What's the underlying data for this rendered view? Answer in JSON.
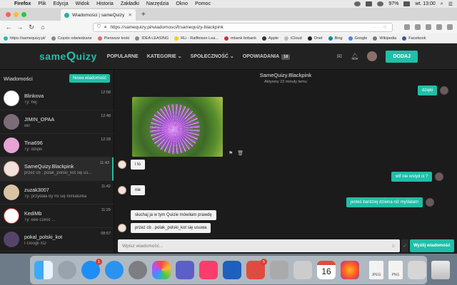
{
  "menubar": {
    "app": "Firefox",
    "items": [
      "Plik",
      "Edycja",
      "Widok",
      "Historia",
      "Zakładki",
      "Narzędzia",
      "Okno",
      "Pomoc"
    ],
    "battery": "97%",
    "clock": "wt. 13:00"
  },
  "browser": {
    "tab_title": "Wiadomości | sameQuizy",
    "new_tab": "+",
    "url": "https://samequizy.pl/wiadomosci/t/samequizy-blackpink",
    "url_actions": "··· ☆",
    "bookmarks": [
      "https://samequizy.pl/",
      "Często odwiedzane",
      "Pierwsze kroki",
      "IDEA LEASING",
      "RLi - Raiffeisen Lea...",
      "mbank bnbank",
      "Apple",
      "iCloud",
      "Onet",
      "Bing",
      "Google",
      "Wikipedia",
      "Facebook"
    ]
  },
  "site": {
    "logo_a": "same",
    "logo_q": "Q",
    "logo_b": "uizy",
    "nav": [
      "POPULARNE",
      "KATEGORIE",
      "SPOŁECZNOŚĆ",
      "OPOWIADANIA"
    ],
    "nav_chevron": "⌄",
    "opowiadania_badge": "18",
    "add_button": "DODAJ"
  },
  "inbox": {
    "title": "Wiadomości",
    "new_button": "Nowa wiadomość",
    "conversations": [
      {
        "name": "Blinkova",
        "preview": "Ty: hej",
        "time": "12:58"
      },
      {
        "name": "JIMIN_OPAA",
        "preview": "ok!",
        "time": "12:48"
      },
      {
        "name": "Tina696",
        "preview": "Ty: dzięki",
        "time": "12:28"
      },
      {
        "name": "SameQuizy.Blackpink",
        "preview": "przez cb . polak_polski_kot się us...",
        "time": "11:43"
      },
      {
        "name": "zuzak3007",
        "preview": "Ty: przydała by mi się miniaturka",
        "time": "11:42"
      },
      {
        "name": "KediMb",
        "preview": "Ty: eee cześć ...",
        "time": "11:29"
      },
      {
        "name": "pokal_polski_kot",
        "preview": "I Googli XD",
        "time": "08:57"
      }
    ]
  },
  "chat": {
    "name": "SameQuizy.Blackpink",
    "status": "Aktywny 23 minuty temu",
    "messages": {
      "m_dzieki": "dzięki",
      "m_i_to": "i to",
      "m_wtf": "wtf nie wstyd ci ?",
      "m_nie": "nie",
      "m_dziwna": "jesteś bardziej dziwna niż myślałam",
      "m_sluchaj": "słuchaj ja w tym Quizie mówiłam prawdę",
      "m_przez": "przez cb . polak_polski_kot się usuwa"
    },
    "composer_placeholder": "Wpisz wiadomość...",
    "send_button": "Wyślij wiadomość"
  },
  "dock": {
    "calendar_day": "16",
    "appstore_badge": "1",
    "photos_badge": "5",
    "files": [
      "JPEG",
      "PNG"
    ]
  }
}
